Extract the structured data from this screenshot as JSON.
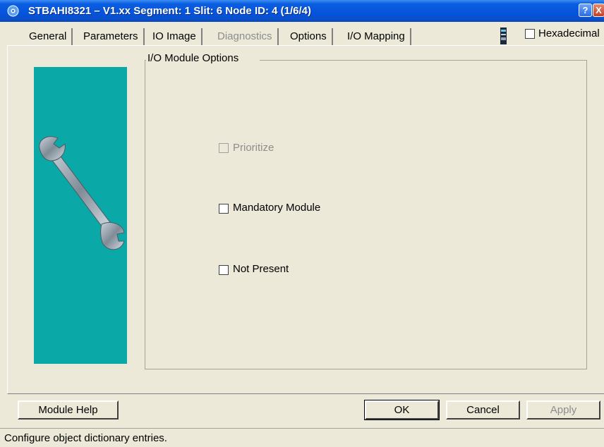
{
  "window": {
    "title": "STBAHI8321 – V1.xx Segment: 1 Slit: 6 Node ID: 4 (1/6/4)",
    "help_button": "?",
    "close_button": "X"
  },
  "tabs": [
    {
      "label": "General",
      "state": "normal"
    },
    {
      "label": "Parameters",
      "state": "normal"
    },
    {
      "label": "IO Image",
      "state": "normal"
    },
    {
      "label": "Diagnostics",
      "state": "disabled"
    },
    {
      "label": "Options",
      "state": "active"
    },
    {
      "label": "I/O Mapping",
      "state": "normal"
    }
  ],
  "hexadecimal": {
    "label": "Hexadecimal",
    "checked": false
  },
  "group": {
    "title": "I/O Module Options",
    "options": [
      {
        "label": "Prioritize",
        "checked": false,
        "enabled": false
      },
      {
        "label": "Mandatory Module",
        "checked": false,
        "enabled": true
      },
      {
        "label": "Not Present",
        "checked": false,
        "enabled": true
      }
    ]
  },
  "buttons": {
    "module_help": "Module Help",
    "ok": "OK",
    "cancel": "Cancel",
    "apply": "Apply"
  },
  "status": {
    "text": "Configure object dictionary entries."
  },
  "colors": {
    "title_bar": "#0554dd",
    "panel_teal": "#0aa9a7",
    "dialog_bg": "#ece9d8"
  }
}
